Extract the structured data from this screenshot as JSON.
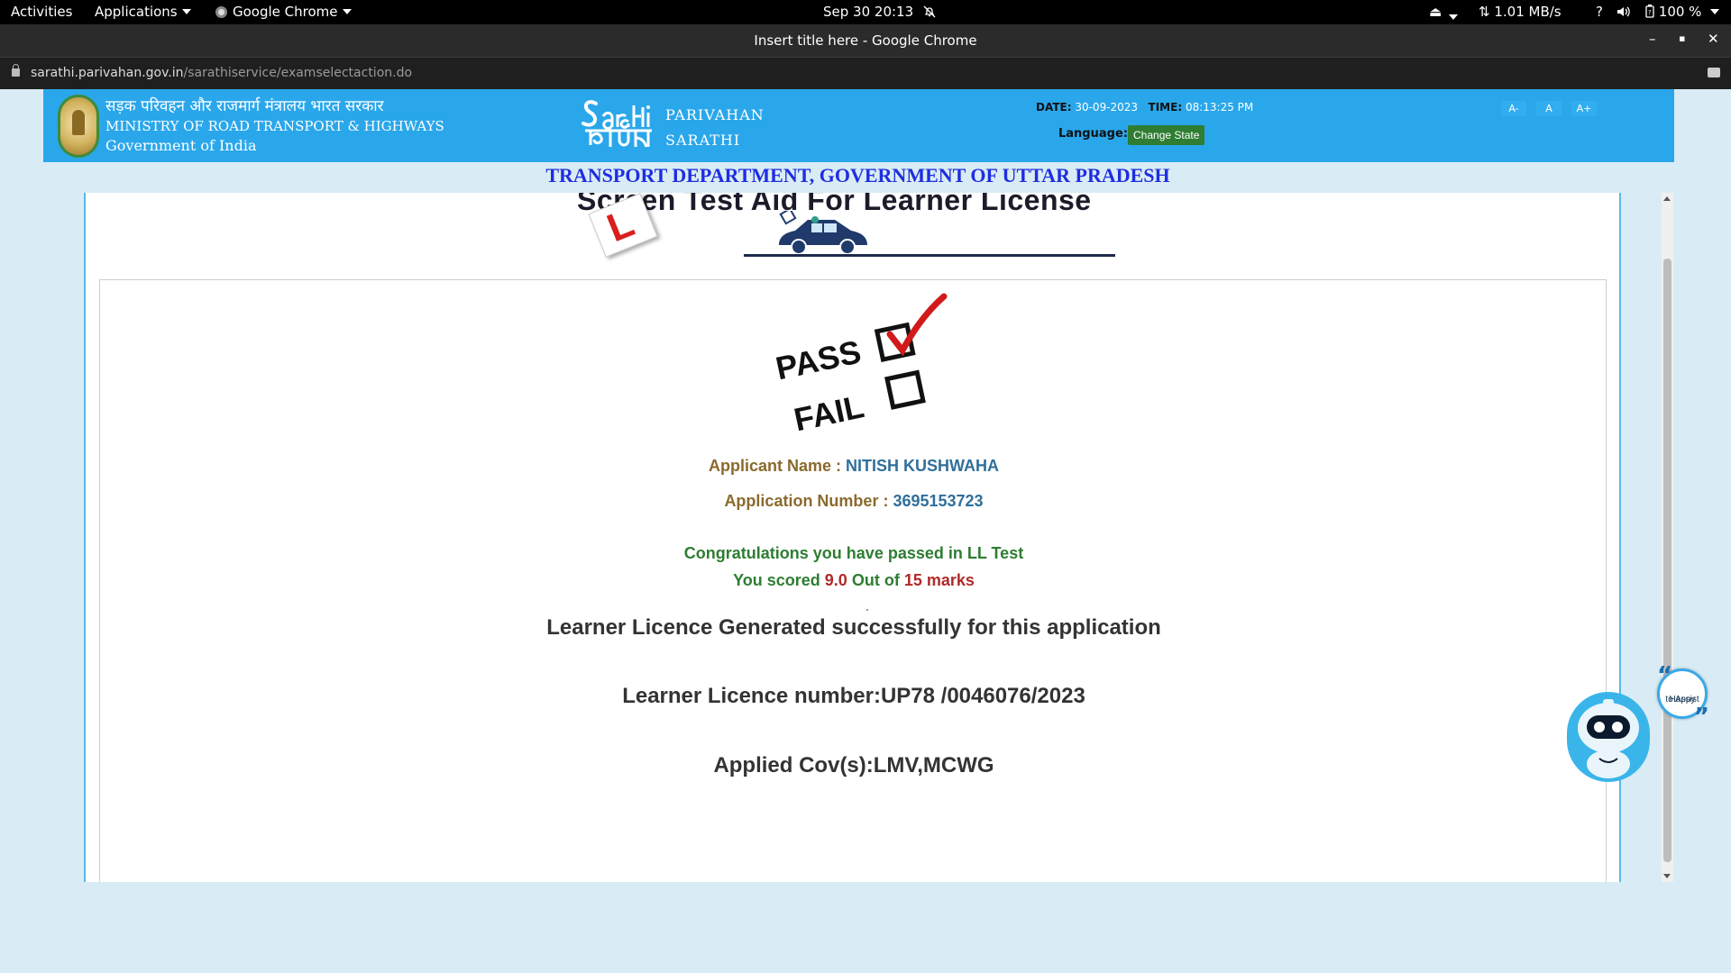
{
  "topbar": {
    "activities": "Activities",
    "applications": "Applications",
    "app_name": "Google Chrome",
    "clock": "Sep 30  20:13",
    "net_speed": "1.01 MB/s",
    "battery": "100 %",
    "help": "?"
  },
  "window": {
    "title": "Insert title here - Google Chrome",
    "minimize": "–",
    "maximize": "▪",
    "close": "✕"
  },
  "address_bar": {
    "host": "sarathi.parivahan.gov.in",
    "path": "/sarathiservice/examselectaction.do"
  },
  "header": {
    "ministry_hindi": "सड़क परिवहन और राजमार्ग मंत्रालय भारत सरकार",
    "ministry_english": "MINISTRY OF ROAD TRANSPORT & HIGHWAYS",
    "government": "Government of India",
    "logo_line1": "PARIVAHAN",
    "logo_line2": "SARATHI",
    "date_label": "DATE:",
    "date_value": "30-09-2023",
    "time_label": "TIME:",
    "time_value": "08:13:25 PM",
    "language_label": "Language:",
    "change_state_button": "Change State",
    "font_decrease": "A-",
    "font_normal": "A",
    "font_increase": "A+"
  },
  "department_title": "TRANSPORT DEPARTMENT, GOVERNMENT OF UTTAR PRADESH",
  "screen_title": "Screen Test Aid For Learner License",
  "result": {
    "pass_text": "PASS",
    "fail_text": "FAIL",
    "applicant_name_label": "Applicant Name : ",
    "applicant_name": "NITISH KUSHWAHA",
    "application_number_label": "Application Number : ",
    "application_number": "3695153723",
    "congratulations": "Congratulations you have passed in LL Test",
    "score_prefix": "You scored ",
    "score": "9.0",
    "score_mid": " Out of ",
    "total": "15 marks",
    "generated_message": "Learner Licence Generated successfully for this application",
    "licence_number_text": "Learner Licence number:UP78 /0046076/2023",
    "applied_cov_text": "Applied Cov(s):LMV,MCWG"
  },
  "chatbot": {
    "bubble_line1": "Happy",
    "bubble_line2": "to Assist"
  },
  "colors": {
    "banner": "#2aa7eb",
    "department_title": "#1f2ee0",
    "label_brown": "#8a6a2c",
    "value_blue": "#2f6f9b",
    "success_green": "#2e7d32",
    "score_red": "#b02a2a"
  }
}
